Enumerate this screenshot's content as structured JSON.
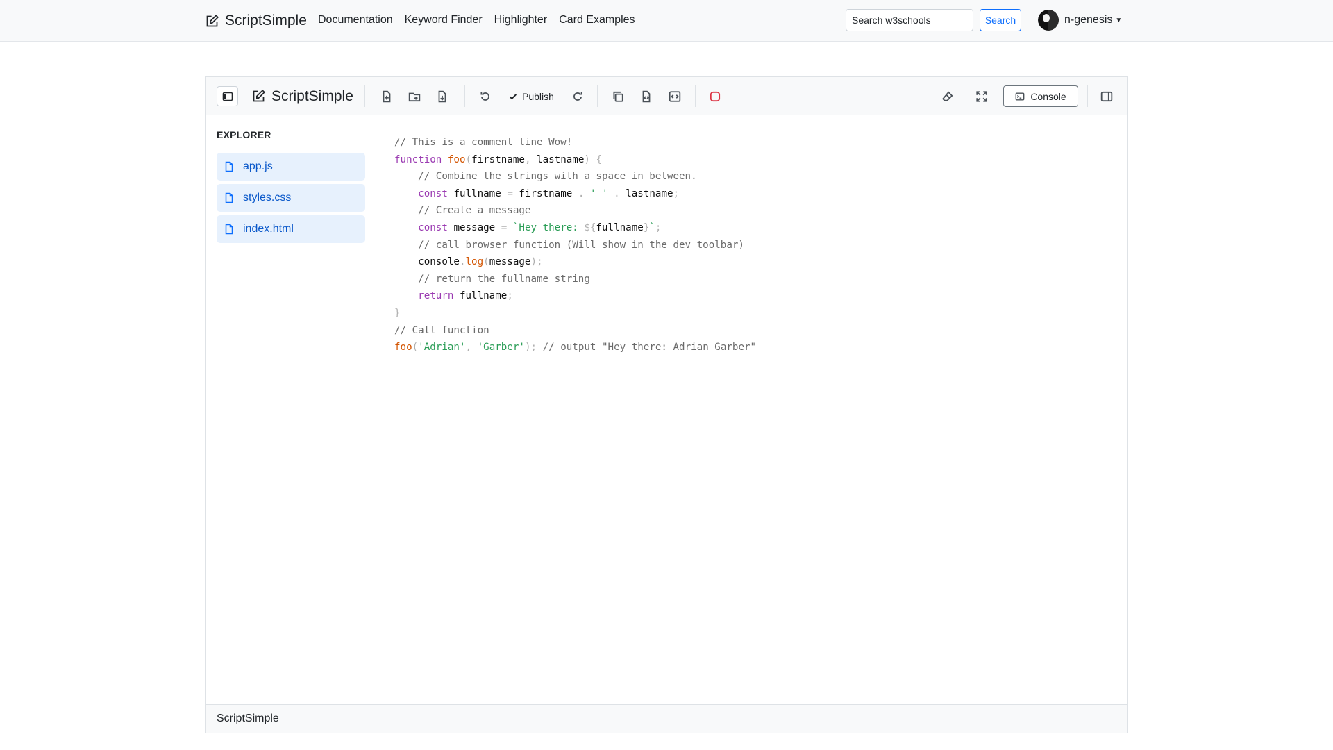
{
  "navbar": {
    "brand": "ScriptSimple",
    "links": [
      "Documentation",
      "Keyword Finder",
      "Highlighter",
      "Card Examples"
    ],
    "search_placeholder": "Search w3schools",
    "search_button": "Search",
    "username": "n-genesis"
  },
  "toolbar": {
    "brand": "ScriptSimple",
    "publish_label": "Publish",
    "console_label": "Console"
  },
  "explorer": {
    "title": "EXPLORER",
    "files": [
      "app.js",
      "styles.css",
      "index.html"
    ]
  },
  "code": {
    "comment_1": "// This is a comment line Wow!",
    "comment_2": "// Combine the strings with a space in between.",
    "comment_3": "// Create a message",
    "comment_4": "// call browser function (Will show in the dev toolbar)",
    "comment_5": "// return the fullname string",
    "comment_6": "// Call function",
    "comment_7": "// output \"Hey there: Adrian Garber\"",
    "kw_function": "function",
    "kw_const": "const",
    "kw_return": "return",
    "fn_foo": "foo",
    "fn_log": "log",
    "var_firstname": "firstname",
    "var_lastname": "lastname",
    "var_fullname": "fullname",
    "var_message": "message",
    "var_console": "console",
    "str_space": "' '",
    "str_template_start": "`Hey there: ",
    "str_adrian": "'Adrian'",
    "str_garber": "'Garber'"
  },
  "footer": {
    "label": "ScriptSimple"
  },
  "colors": {
    "accent": "#0d6efd",
    "file_bg": "#e7f1fd",
    "stop_icon": "#dc3545"
  }
}
